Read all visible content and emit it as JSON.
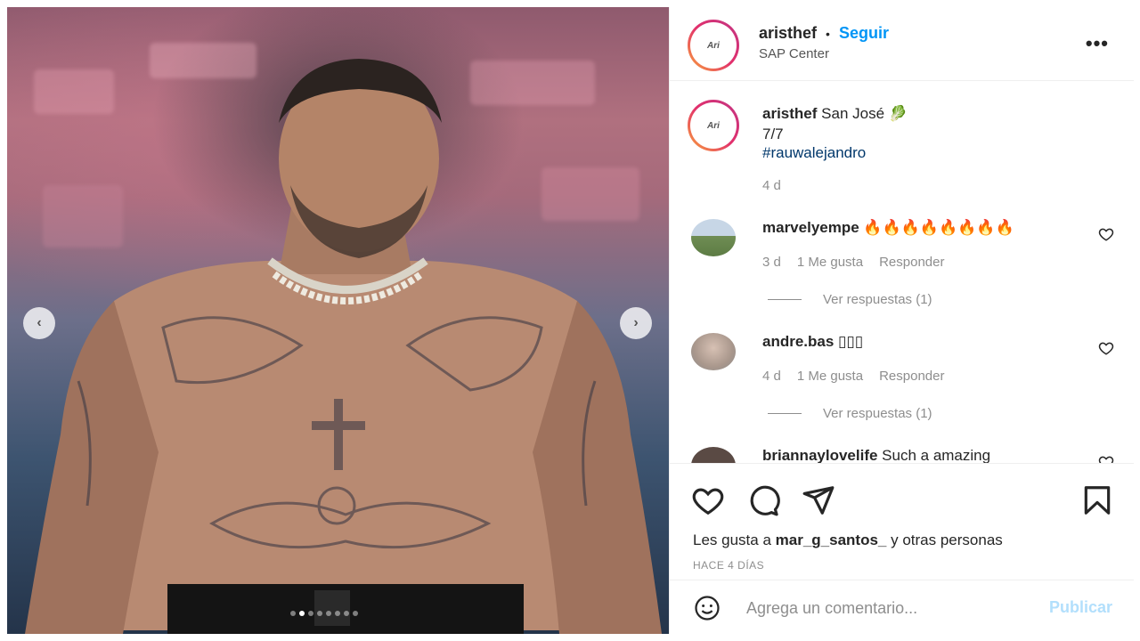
{
  "post": {
    "author": "aristhef",
    "separator": "•",
    "follow_label": "Seguir",
    "location": "SAP Center",
    "avatar_text": "Ari",
    "more_icon": "more-horizontal-icon",
    "carousel": {
      "prev_icon": "chevron-left-icon",
      "next_icon": "chevron-right-icon",
      "total": 8,
      "active_index": 1
    }
  },
  "caption": {
    "author": "aristhef",
    "text": "San José 🥬",
    "line2": "7/7",
    "hashtag": "#rauwalejandro",
    "age": "4 d"
  },
  "comments": [
    {
      "author": "marvelyempe",
      "text": "🔥🔥🔥🔥🔥🔥🔥🔥",
      "age": "3 d",
      "likes": "1 Me gusta",
      "reply": "Responder",
      "view_replies": "Ver respuestas (1)"
    },
    {
      "author": "andre.bas",
      "text": "▯▯▯",
      "age": "4 d",
      "likes": "1 Me gusta",
      "reply": "Responder",
      "view_replies": "Ver respuestas (1)"
    },
    {
      "author": "briannaylovelife",
      "text": "Such a amazing"
    }
  ],
  "actions": {
    "liked_by_prefix": "Les gusta a",
    "liked_by_user": "mar_g_santos_",
    "liked_by_suffix": "y otras personas",
    "timestamp": "HACE 4 DÍAS"
  },
  "comment_box": {
    "placeholder": "Agrega un comentario...",
    "publish_label": "Publicar"
  },
  "colors": {
    "accent": "#0095f6",
    "hashtag": "#00376b",
    "muted": "#8e8e8e",
    "publish_disabled": "#b2dffc"
  }
}
